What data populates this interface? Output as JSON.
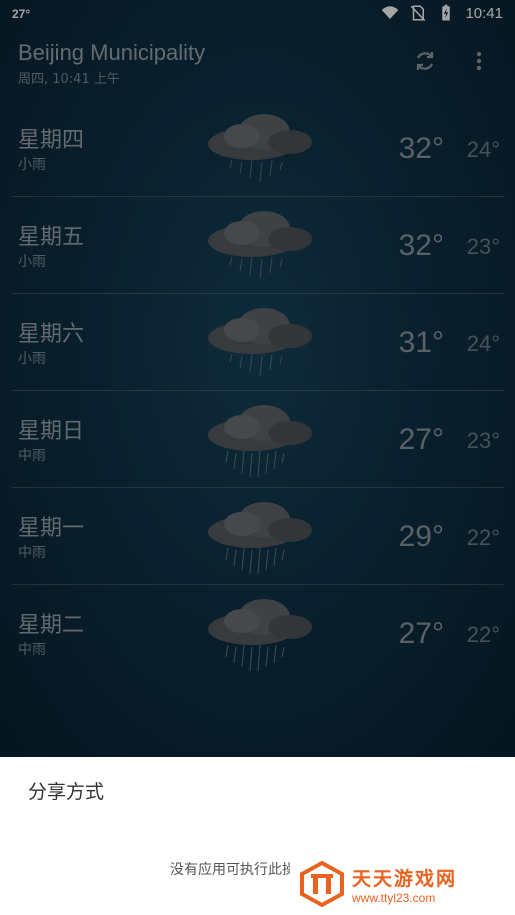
{
  "status_bar": {
    "temperature": "27°",
    "time": "10:41",
    "icons": [
      "wifi-icon",
      "no-sim-icon",
      "battery-charging-icon"
    ]
  },
  "header": {
    "city": "Beijing Municipality",
    "datetime": "周四, 10:41 上午",
    "refresh_icon": "refresh-icon",
    "more_icon": "more-vert-icon"
  },
  "forecast": [
    {
      "day": "星期四",
      "condition": "小雨",
      "high": "32°",
      "low": "24°",
      "icon": "rain-cloud-icon"
    },
    {
      "day": "星期五",
      "condition": "小雨",
      "high": "32°",
      "low": "23°",
      "icon": "rain-cloud-icon"
    },
    {
      "day": "星期六",
      "condition": "小雨",
      "high": "31°",
      "low": "24°",
      "icon": "rain-cloud-icon"
    },
    {
      "day": "星期日",
      "condition": "中雨",
      "high": "27°",
      "low": "23°",
      "icon": "rain-cloud-icon"
    },
    {
      "day": "星期一",
      "condition": "中雨",
      "high": "29°",
      "low": "22°",
      "icon": "rain-cloud-icon"
    },
    {
      "day": "星期二",
      "condition": "中雨",
      "high": "27°",
      "low": "22°",
      "icon": "rain-cloud-icon"
    }
  ],
  "share_sheet": {
    "title": "分享方式",
    "empty_message": "没有应用可执行此操作"
  },
  "watermark": {
    "name": "天天游戏网",
    "url": "www.ttyl23.com"
  },
  "colors": {
    "background": "#0f3146",
    "sheet": "#ffffff",
    "watermark": "#e9621f"
  }
}
